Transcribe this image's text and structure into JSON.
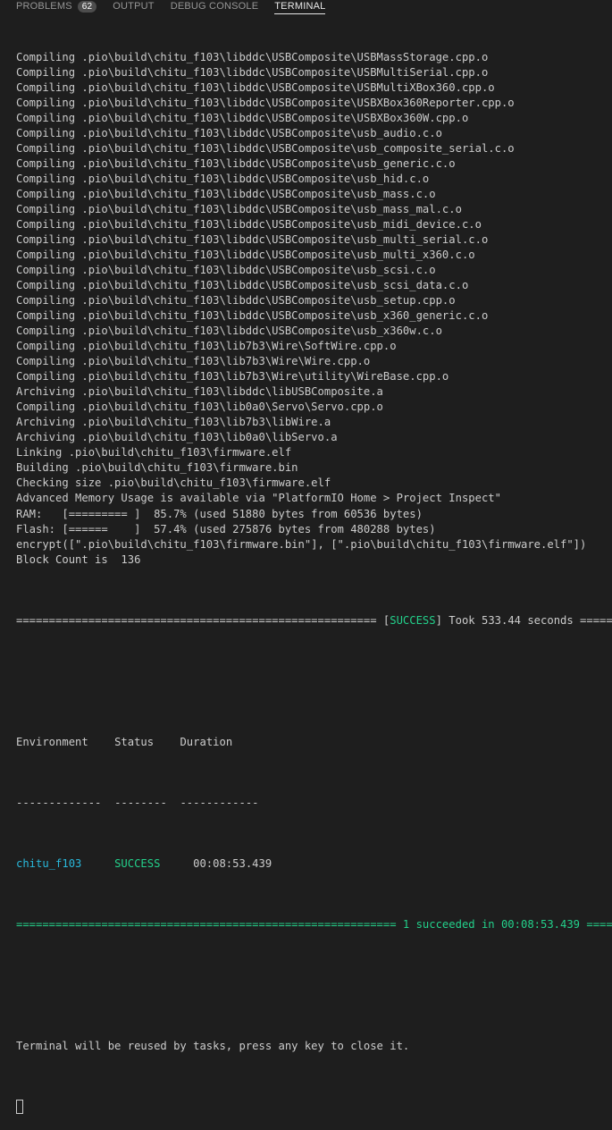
{
  "tabs": [
    {
      "label": "PROBLEMS",
      "badge": "62"
    },
    {
      "label": "OUTPUT"
    },
    {
      "label": "DEBUG CONSOLE"
    },
    {
      "label": "TERMINAL"
    }
  ],
  "lines": [
    "Compiling .pio\\build\\chitu_f103\\libddc\\USBComposite\\USBMassStorage.cpp.o",
    "Compiling .pio\\build\\chitu_f103\\libddc\\USBComposite\\USBMultiSerial.cpp.o",
    "Compiling .pio\\build\\chitu_f103\\libddc\\USBComposite\\USBMultiXBox360.cpp.o",
    "Compiling .pio\\build\\chitu_f103\\libddc\\USBComposite\\USBXBox360Reporter.cpp.o",
    "Compiling .pio\\build\\chitu_f103\\libddc\\USBComposite\\USBXBox360W.cpp.o",
    "Compiling .pio\\build\\chitu_f103\\libddc\\USBComposite\\usb_audio.c.o",
    "Compiling .pio\\build\\chitu_f103\\libddc\\USBComposite\\usb_composite_serial.c.o",
    "Compiling .pio\\build\\chitu_f103\\libddc\\USBComposite\\usb_generic.c.o",
    "Compiling .pio\\build\\chitu_f103\\libddc\\USBComposite\\usb_hid.c.o",
    "Compiling .pio\\build\\chitu_f103\\libddc\\USBComposite\\usb_mass.c.o",
    "Compiling .pio\\build\\chitu_f103\\libddc\\USBComposite\\usb_mass_mal.c.o",
    "Compiling .pio\\build\\chitu_f103\\libddc\\USBComposite\\usb_midi_device.c.o",
    "Compiling .pio\\build\\chitu_f103\\libddc\\USBComposite\\usb_multi_serial.c.o",
    "Compiling .pio\\build\\chitu_f103\\libddc\\USBComposite\\usb_multi_x360.c.o",
    "Compiling .pio\\build\\chitu_f103\\libddc\\USBComposite\\usb_scsi.c.o",
    "Compiling .pio\\build\\chitu_f103\\libddc\\USBComposite\\usb_scsi_data.c.o",
    "Compiling .pio\\build\\chitu_f103\\libddc\\USBComposite\\usb_setup.cpp.o",
    "Compiling .pio\\build\\chitu_f103\\libddc\\USBComposite\\usb_x360_generic.c.o",
    "Compiling .pio\\build\\chitu_f103\\libddc\\USBComposite\\usb_x360w.c.o",
    "Compiling .pio\\build\\chitu_f103\\lib7b3\\Wire\\SoftWire.cpp.o",
    "Compiling .pio\\build\\chitu_f103\\lib7b3\\Wire\\Wire.cpp.o",
    "Compiling .pio\\build\\chitu_f103\\lib7b3\\Wire\\utility\\WireBase.cpp.o",
    "Archiving .pio\\build\\chitu_f103\\libddc\\libUSBComposite.a",
    "Compiling .pio\\build\\chitu_f103\\lib0a0\\Servo\\Servo.cpp.o",
    "Archiving .pio\\build\\chitu_f103\\lib7b3\\libWire.a",
    "Archiving .pio\\build\\chitu_f103\\lib0a0\\libServo.a",
    "Linking .pio\\build\\chitu_f103\\firmware.elf",
    "Building .pio\\build\\chitu_f103\\firmware.bin",
    "Checking size .pio\\build\\chitu_f103\\firmware.elf",
    "Advanced Memory Usage is available via \"PlatformIO Home > Project Inspect\"",
    "RAM:   [========= ]  85.7% (used 51880 bytes from 60536 bytes)",
    "Flash: [======    ]  57.4% (used 275876 bytes from 480288 bytes)",
    "encrypt([\".pio\\build\\chitu_f103\\firmware.bin\"], [\".pio\\build\\chitu_f103\\firmware.elf\"])",
    "Block Count is  136"
  ],
  "success_line": {
    "prefix": "======================================================= [",
    "status": "SUCCESS",
    "suffix": "] Took 533.44 seconds ========================"
  },
  "summary": {
    "headers": [
      "Environment",
      "Status",
      "Duration"
    ],
    "dashes": [
      "-------------",
      "--------",
      "------------"
    ],
    "row": {
      "environment": "chitu_f103",
      "status": "SUCCESS",
      "duration": "00:08:53.439"
    },
    "result_line": "========================================================== 1 succeeded in 00:08:53.439 =========================="
  },
  "footer": "Terminal will be reused by tasks, press any key to close it.",
  "colors": {
    "background": "#1e1e1e",
    "text": "#cccccc",
    "success": "#23d18b",
    "environment": "#29b8db"
  }
}
